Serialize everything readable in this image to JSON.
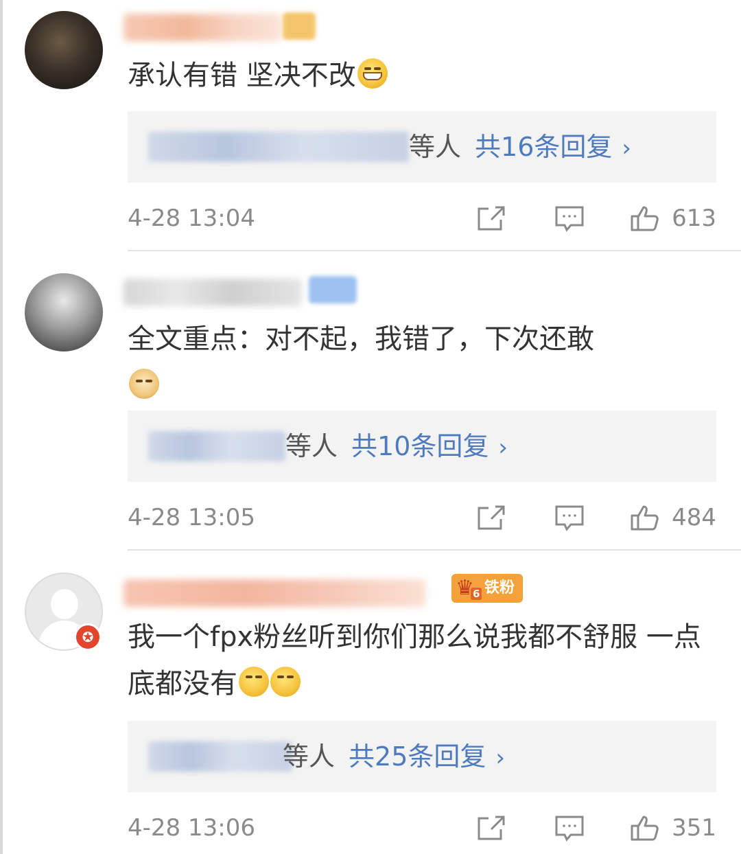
{
  "comments": [
    {
      "text": "承认有错 坚决不改",
      "emojis": [
        "grin-emoji"
      ],
      "replies": {
        "names_suffix": "等人",
        "count_label": "共16条回复"
      },
      "timestamp": "4-28 13:04",
      "likes": "613"
    },
    {
      "text": "全文重点：对不起，我错了，下次还敢",
      "emojis": [
        "doge-emoji"
      ],
      "replies": {
        "names_suffix": "等人",
        "count_label": "共10条回复"
      },
      "timestamp": "4-28 13:05",
      "likes": "484"
    },
    {
      "text": "我一个fpx粉丝听到你们那么说我都不舒服 一点底都没有",
      "emojis": [
        "smirk-emoji",
        "smirk-emoji"
      ],
      "badge": {
        "label": "铁粉",
        "level": "6"
      },
      "replies": {
        "names_suffix": "等人",
        "count_label": "共25条回复"
      },
      "timestamp": "4-28 13:06",
      "likes": "351"
    }
  ],
  "reply_chevron": "›",
  "colors": {
    "link_blue": "#4f7bbd",
    "meta_gray": "#8a8a8a",
    "reply_bg": "#f3f3f3",
    "fan_badge": "#f3a23b"
  }
}
